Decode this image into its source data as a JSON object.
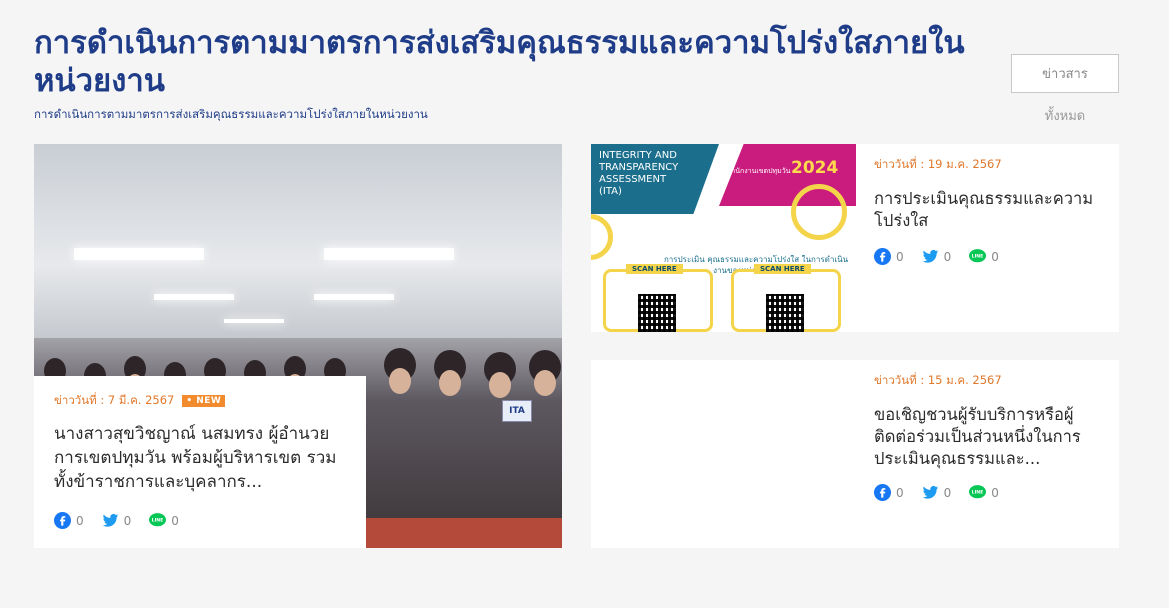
{
  "header": {
    "title": "การดำเนินการตามมาตรการส่งเสริมคุณธรรมและความโปร่งใสภายในหน่วยงาน",
    "subtitle": "การดำเนินการตามมาตรการส่งเสริมคุณธรรมและความโปร่งใสภายในหน่วยงาน",
    "all_news_line1": "ข่าวสาร",
    "all_news_line2": "ทั้งหมด"
  },
  "featured": {
    "date": "ข่าววันที่ : 7 มี.ค. 2567",
    "badge": "NEW",
    "headline": "นางสาวสุขวิชญาณ์ นสมทรง ผู้อำนวยการเขตปทุมวัน พร้อมผู้บริหารเขต รวมทั้งข้าราชการและบุคลากร...",
    "facebook_count": "0",
    "twitter_count": "0",
    "line_count": "0",
    "image_sign": "ITA"
  },
  "news": [
    {
      "date": "ข่าววันที่ : 19 ม.ค. 2567",
      "headline": "การประเมินคุณธรรมและความโปร่งใส",
      "facebook_count": "0",
      "twitter_count": "0",
      "line_count": "0",
      "poster": {
        "heading": "INTEGRITY AND TRANSPARENCY ASSESSMENT (ITA)",
        "year": "2024",
        "small": "สำนักงานเขตปทุมวัน",
        "middle": "การประเมิน คุณธรรมและความโปร่งใส ในการดำเนินงานของหน่วยงานภาครัฐ",
        "scan_label": "SCAN HERE"
      }
    },
    {
      "date": "ข่าววันที่ : 15 ม.ค. 2567",
      "headline": "ขอเชิญชวนผู้รับบริการหรือผู้ติดต่อร่วมเป็นส่วนหนึ่งในการประเมินคุณธรรมและ...",
      "facebook_count": "0",
      "twitter_count": "0",
      "line_count": "0"
    }
  ],
  "colors": {
    "title": "#1f3c88",
    "date": "#e0772a",
    "facebook": "#1877f2",
    "twitter": "#1d9bf0",
    "line": "#06c755"
  },
  "icons": [
    "facebook-icon",
    "twitter-icon",
    "line-icon"
  ]
}
